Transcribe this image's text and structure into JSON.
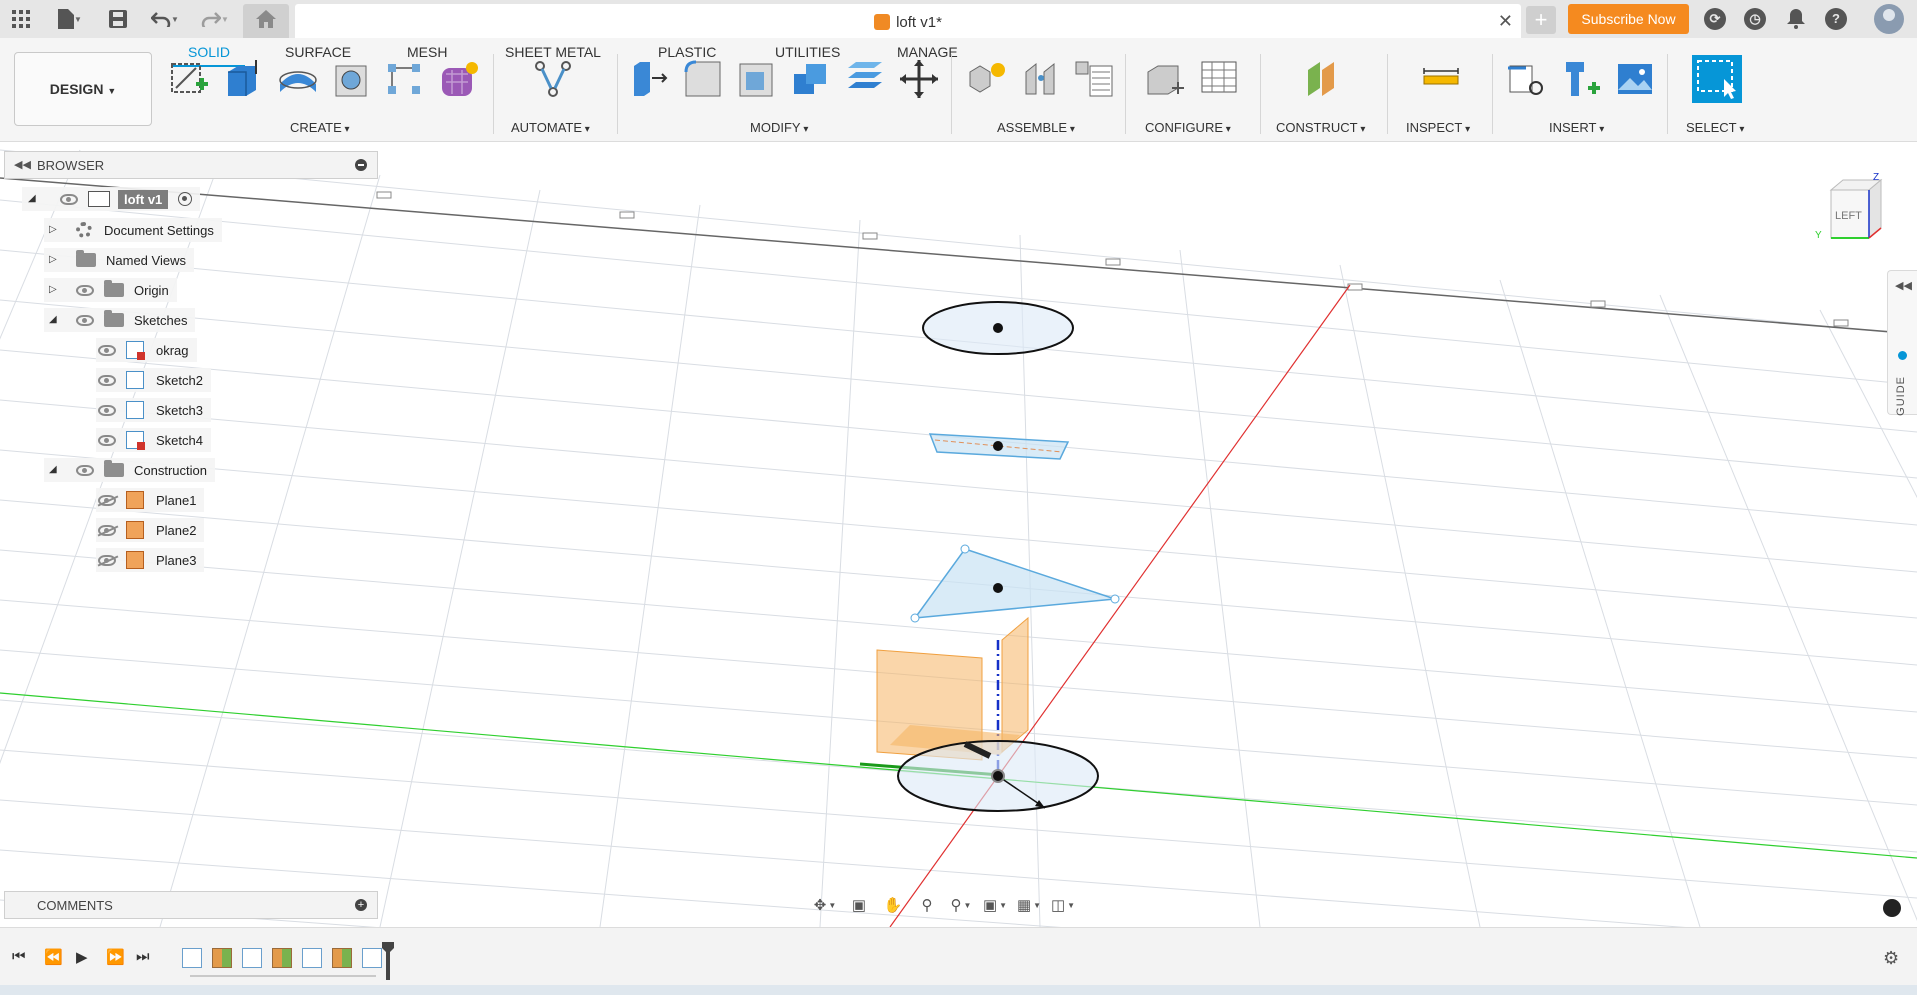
{
  "titlebar": {
    "doc_title": "loft v1*",
    "subscribe_label": "Subscribe Now",
    "icons": [
      "apps-grid-icon",
      "file-menu-icon",
      "save-icon",
      "undo-icon",
      "redo-icon",
      "home-icon",
      "close-icon",
      "new-tab-icon",
      "extensions-icon",
      "job-status-icon",
      "notifications-icon",
      "help-icon",
      "user-avatar"
    ]
  },
  "toolbar": {
    "workspace_label": "DESIGN",
    "tabs": [
      "SOLID",
      "SURFACE",
      "MESH",
      "SHEET METAL",
      "PLASTIC",
      "UTILITIES",
      "MANAGE"
    ],
    "active_tab": "SOLID",
    "groups": {
      "create": "CREATE",
      "automate": "AUTOMATE",
      "modify": "MODIFY",
      "assemble": "ASSEMBLE",
      "configure": "CONFIGURE",
      "construct": "CONSTRUCT",
      "inspect": "INSPECT",
      "insert": "INSERT",
      "select": "SELECT"
    }
  },
  "browser": {
    "title": "BROWSER",
    "root": "loft v1",
    "items": {
      "document_settings": "Document Settings",
      "named_views": "Named Views",
      "origin": "Origin",
      "sketches": "Sketches",
      "sketch_1": "okrag",
      "sketch_2": "Sketch2",
      "sketch_3": "Sketch3",
      "sketch_4": "Sketch4",
      "construction": "Construction",
      "plane_1": "Plane1",
      "plane_2": "Plane2",
      "plane_3": "Plane3"
    }
  },
  "comments": {
    "title": "COMMENTS"
  },
  "viewcube": {
    "face": "LEFT",
    "axis_z": "Z",
    "axis_y": "Y"
  },
  "guide": {
    "label": "GUIDE"
  },
  "colors": {
    "accent": "#0696d7",
    "subscribe": "#f58a1f",
    "plane": "#f5b565",
    "x_axis": "#e03030",
    "y_axis": "#2fcf2f",
    "z_axis": "#1530c8"
  }
}
